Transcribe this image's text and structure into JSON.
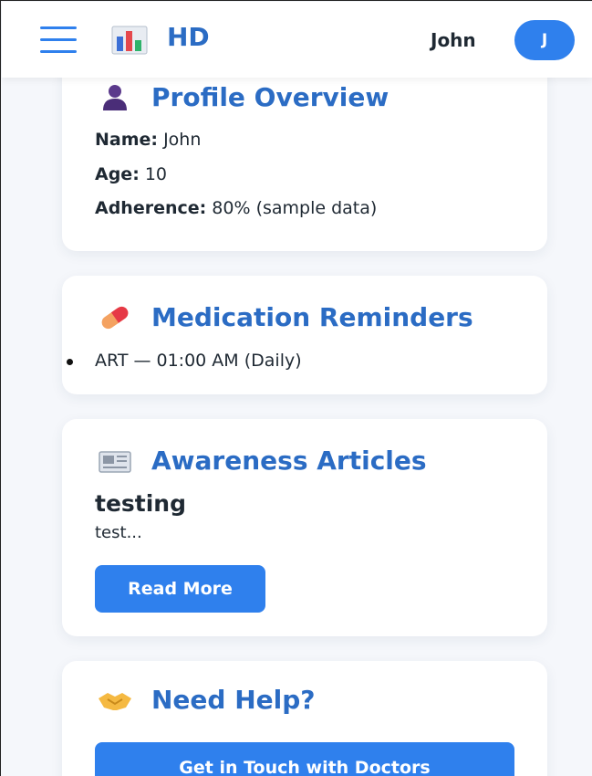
{
  "header": {
    "brand": "HD",
    "brand_icon": "bar-chart-icon",
    "user_name": "John",
    "avatar_initial": "J",
    "menu_icon": "hamburger-menu-icon"
  },
  "profile": {
    "title": "Profile Overview",
    "icon": "user-silhouette-icon",
    "name_label": "Name:",
    "name_value": "John",
    "age_label": "Age:",
    "age_value": "10",
    "adherence_label": "Adherence:",
    "adherence_value": "80% (sample data)"
  },
  "medication": {
    "title": "Medication Reminders",
    "icon": "pill-icon",
    "items": [
      "ART — 01:00 AM (Daily)"
    ]
  },
  "articles": {
    "title": "Awareness Articles",
    "icon": "newspaper-icon",
    "article_title": "testing",
    "article_excerpt": "test...",
    "read_more_label": "Read More"
  },
  "help": {
    "title": "Need Help?",
    "icon": "handshake-icon",
    "button_label": "Get in Touch with Doctors"
  },
  "colors": {
    "accent": "#2f80ed",
    "heading": "#2b6cc4",
    "background": "#f5f7fb"
  }
}
